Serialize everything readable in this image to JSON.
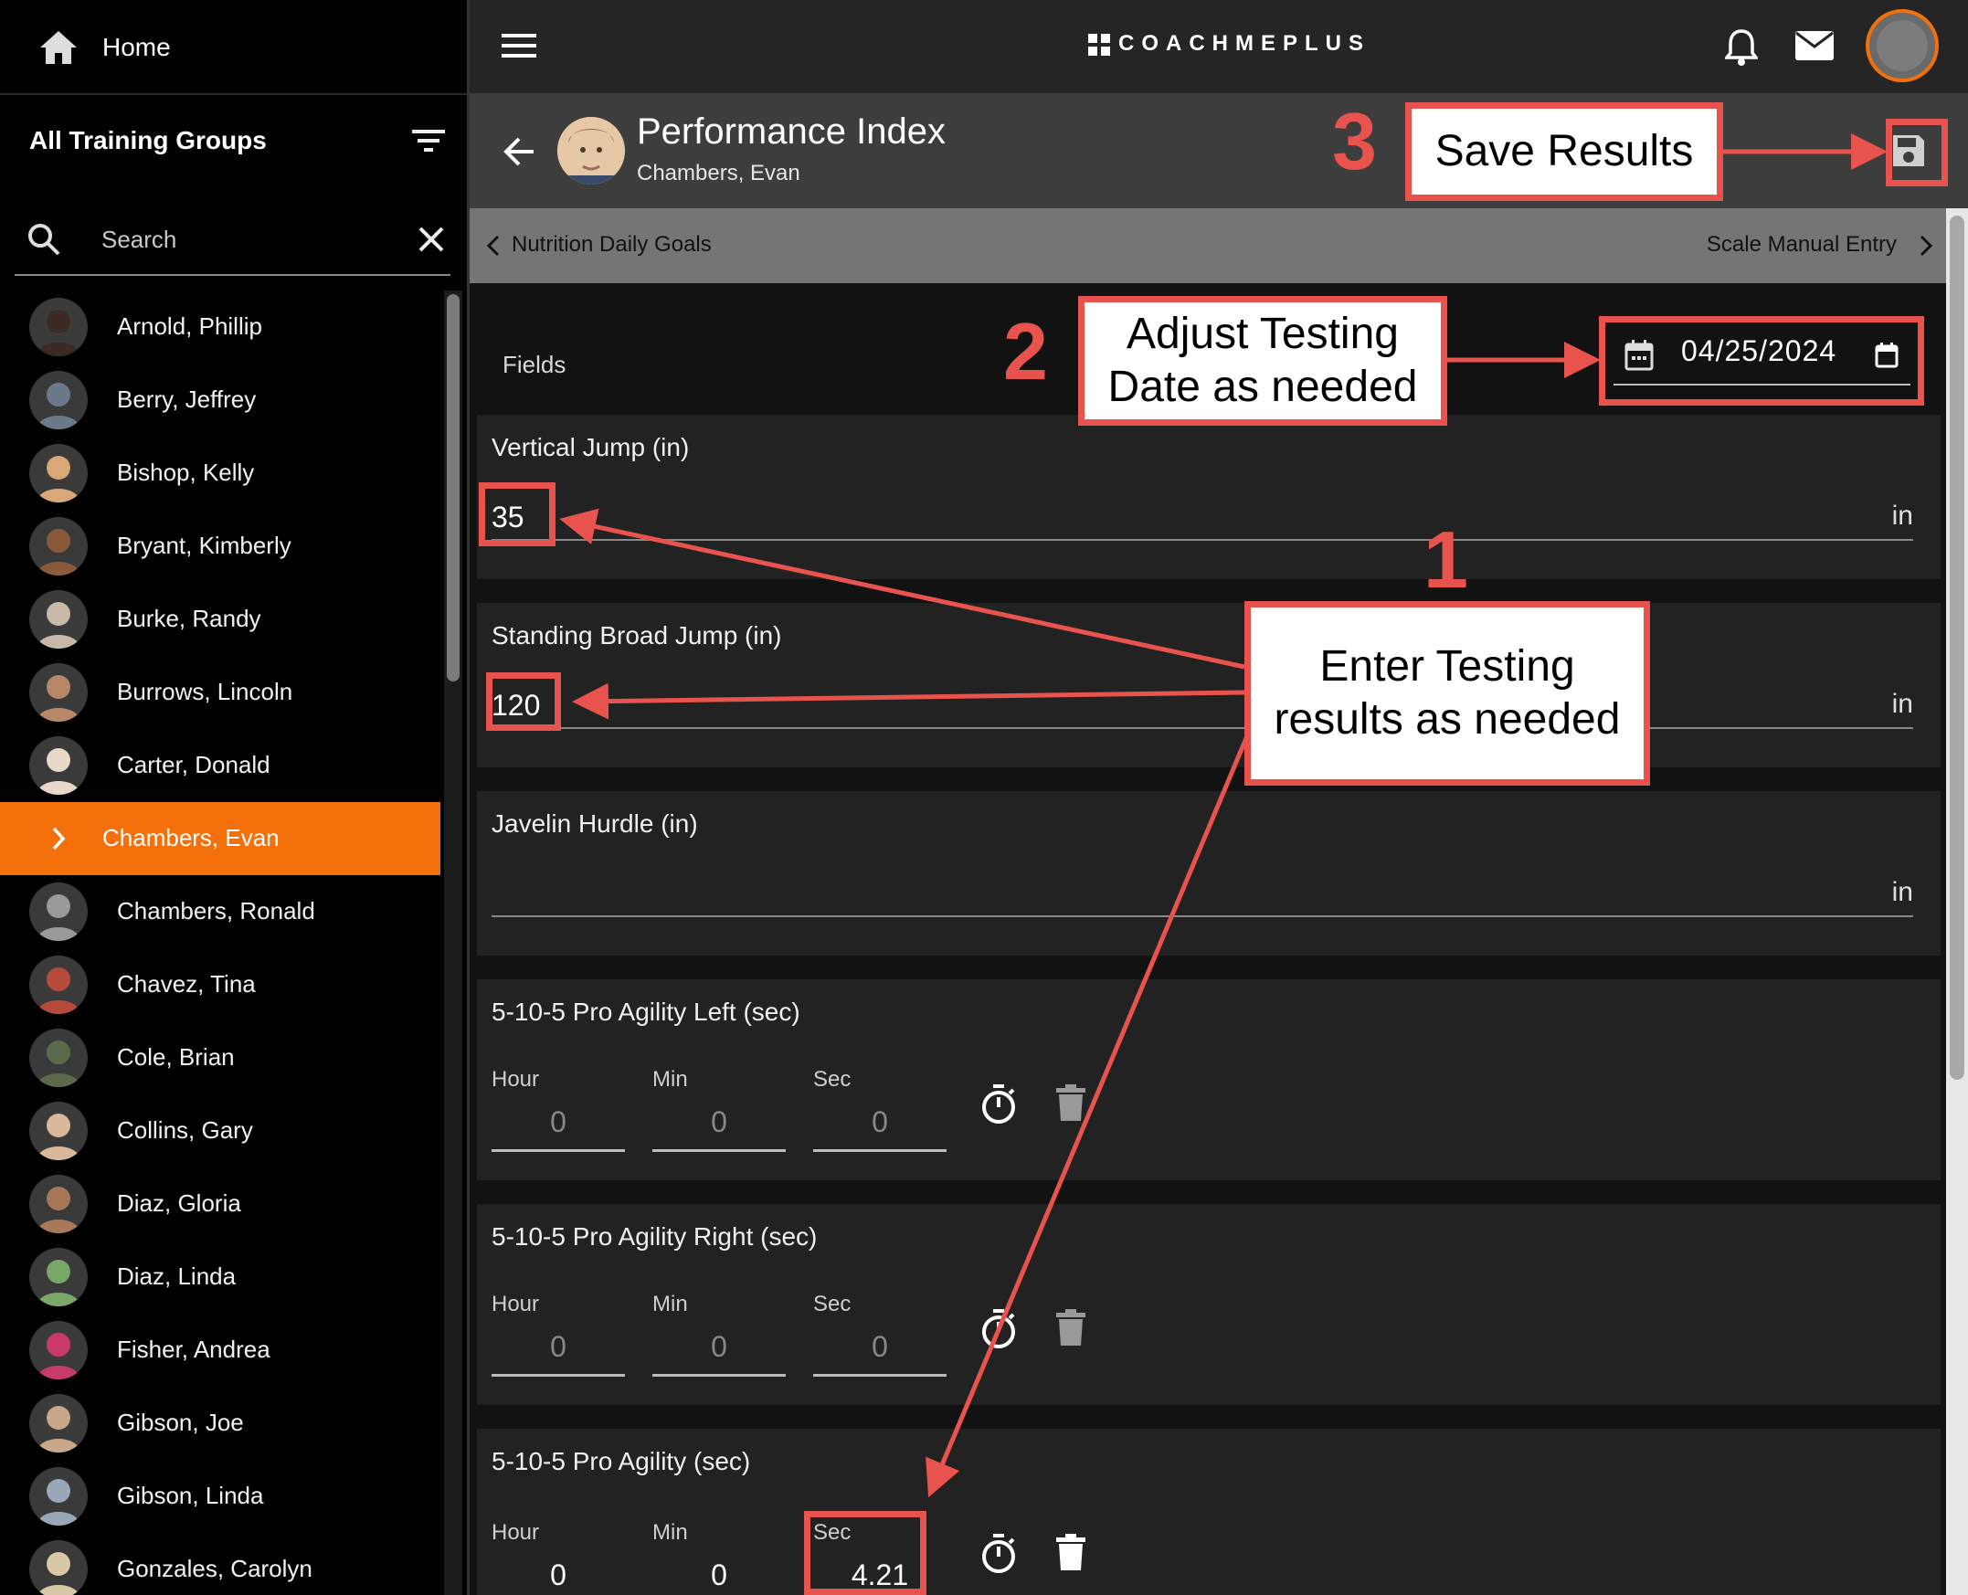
{
  "sidebar": {
    "home_label": "Home",
    "groups_label": "All Training Groups",
    "search_placeholder": "Search",
    "athletes": [
      {
        "name": "Arnold, Phillip",
        "color": "#3a2a22"
      },
      {
        "name": "Berry, Jeffrey",
        "color": "#6a7a8a"
      },
      {
        "name": "Bishop, Kelly",
        "color": "#d8a878"
      },
      {
        "name": "Bryant, Kimberly",
        "color": "#8a5a3a"
      },
      {
        "name": "Burke, Randy",
        "color": "#c8b8a8"
      },
      {
        "name": "Burrows, Lincoln",
        "color": "#b88868"
      },
      {
        "name": "Carter, Donald",
        "color": "#e8d8c8"
      },
      {
        "name": "Chambers, Evan",
        "active": true
      },
      {
        "name": "Chambers, Ronald",
        "color": "#9a9a9a"
      },
      {
        "name": "Chavez, Tina",
        "color": "#b84a3a"
      },
      {
        "name": "Cole, Brian",
        "color": "#5a6a4a"
      },
      {
        "name": "Collins, Gary",
        "color": "#d8b898"
      },
      {
        "name": "Diaz, Gloria",
        "color": "#a87858"
      },
      {
        "name": "Diaz, Linda",
        "color": "#7aa86a"
      },
      {
        "name": "Fisher, Andrea",
        "color": "#c83a6a"
      },
      {
        "name": "Gibson, Joe",
        "color": "#c8a888"
      },
      {
        "name": "Gibson, Linda",
        "color": "#98a8b8"
      },
      {
        "name": "Gonzales, Carolyn",
        "color": "#d8c8a8"
      }
    ]
  },
  "topbar": {
    "logo": "COACHMEPLUS"
  },
  "profile": {
    "title": "Performance Index",
    "athlete": "Chambers, Evan"
  },
  "nav": {
    "prev": "Nutrition Daily Goals",
    "next": "Scale Manual Entry"
  },
  "form": {
    "fields_label": "Fields",
    "date": "04/25/2024",
    "vertical_jump": {
      "label": "Vertical Jump (in)",
      "value": "35",
      "unit": "in"
    },
    "broad_jump": {
      "label": "Standing Broad Jump (in)",
      "value": "120",
      "unit": "in"
    },
    "javelin": {
      "label": "Javelin Hurdle (in)",
      "value": "",
      "unit": "in"
    },
    "agility_left": {
      "label": "5-10-5 Pro Agility Left (sec)",
      "hour_label": "Hour",
      "min_label": "Min",
      "sec_label": "Sec",
      "hour": "0",
      "min": "0",
      "sec": "0"
    },
    "agility_right": {
      "label": "5-10-5 Pro Agility Right (sec)",
      "hour_label": "Hour",
      "min_label": "Min",
      "sec_label": "Sec",
      "hour": "0",
      "min": "0",
      "sec": "0"
    },
    "agility": {
      "label": "5-10-5 Pro Agility (sec)",
      "hour_label": "Hour",
      "min_label": "Min",
      "sec_label": "Sec",
      "hour": "0",
      "min": "0",
      "sec": "4.21"
    }
  },
  "annotations": {
    "step1": {
      "number": "1",
      "text": "Enter Testing results as needed"
    },
    "step2": {
      "number": "2",
      "text": "Adjust Testing Date as needed"
    },
    "step3": {
      "number": "3",
      "text": "Save Results"
    },
    "color": "#e8534d"
  },
  "colors": {
    "accent": "#f4700a",
    "background": "#121212"
  }
}
